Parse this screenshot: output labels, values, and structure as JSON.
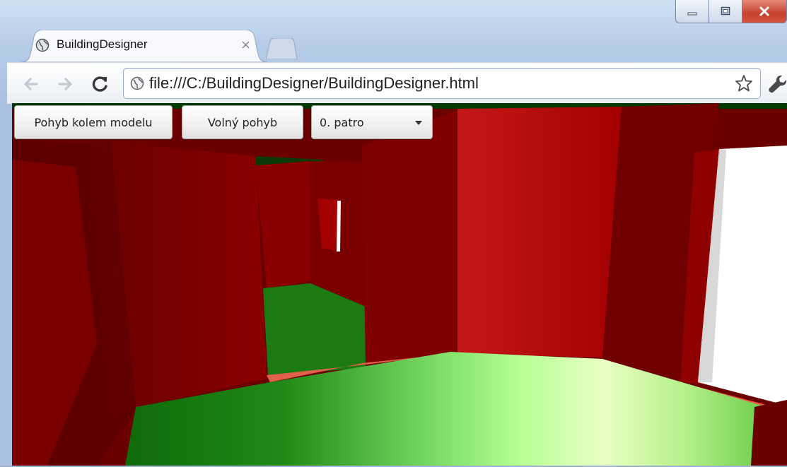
{
  "window": {
    "controls": [
      "minimize-icon",
      "maximize-icon",
      "close-icon"
    ]
  },
  "tab": {
    "title": "BuildingDesigner",
    "close_glyph": "×",
    "favicon": "globe-icon"
  },
  "toolbar": {
    "url": "file:///C:/BuildingDesigner/BuildingDesigner.html",
    "icons": [
      "back-arrow-icon",
      "forward-arrow-icon",
      "reload-icon",
      "page-icon",
      "bookmark-star-icon",
      "wrench-icon"
    ]
  },
  "app": {
    "orbit_button": "Pohyb kolem modelu",
    "free_button": "Volný pohyb",
    "floor_select": "0. patro"
  },
  "colors": {
    "wall": "#a00000",
    "floor": "#1f7a14",
    "door": "#ffffff",
    "close_button": "#c5412d"
  }
}
